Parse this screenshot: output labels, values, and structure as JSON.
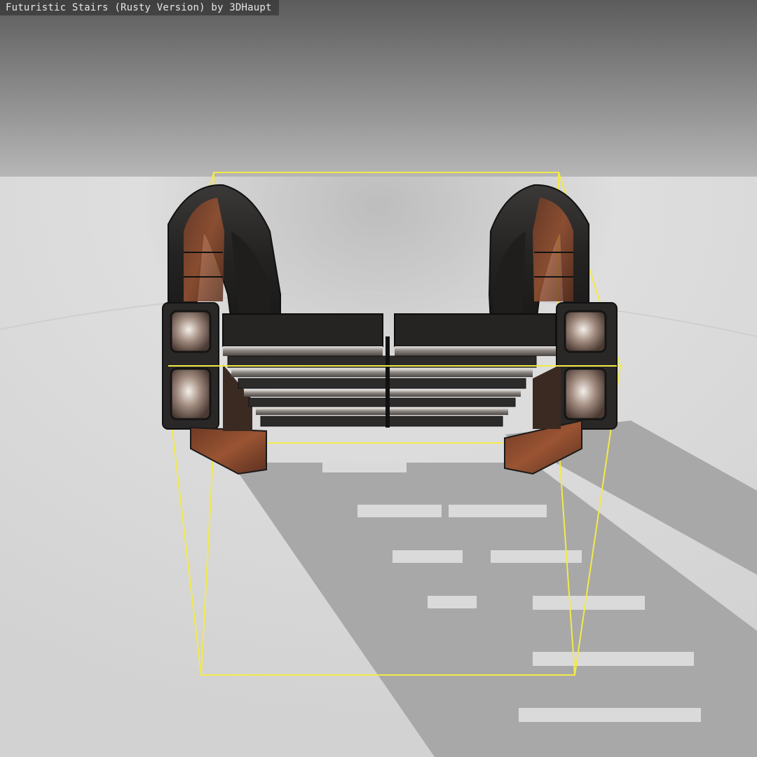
{
  "viewer": {
    "title": "Futuristic Stairs (Rusty Version) by 3DHaupt"
  },
  "colors": {
    "bounding_box": "#f2ea4a",
    "sky_top": "#5e5e5e",
    "sky_bottom": "#b4b4b4",
    "floor": "#d9d9d9",
    "shadow": "#a9a9a9",
    "metal_dark": "#2b2a29",
    "rust": "#8a4a2e",
    "chrome": "#c8c4c0"
  },
  "model": {
    "name": "futuristic-stairs-model",
    "bounding_box_visible": true
  }
}
